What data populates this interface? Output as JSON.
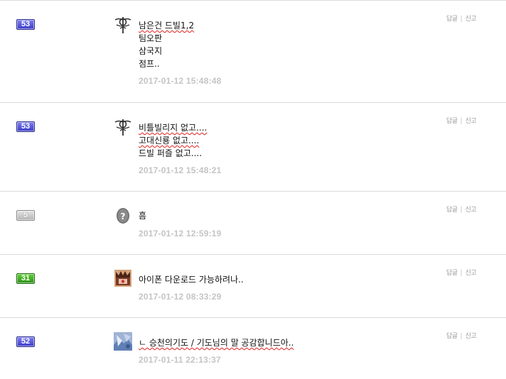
{
  "comments": [
    {
      "level": "53",
      "level_color": "blue",
      "avatar": "alchemy-symbol-icon",
      "lines": [
        "남은건 드빌1,2",
        "팀오판",
        "삼국지",
        "점프.."
      ],
      "date": "2017-01-12 15:48:48",
      "reply_label": "답글",
      "report_label": "신고"
    },
    {
      "level": "53",
      "level_color": "blue",
      "avatar": "alchemy-symbol-icon",
      "lines": [
        "비틀빌리지 없고....",
        "고대신룡 없고....",
        "드빌 퍼즐 없고...."
      ],
      "date": "2017-01-12 15:48:21",
      "reply_label": "답글",
      "report_label": "신고"
    },
    {
      "level": "5",
      "level_color": "gray",
      "avatar": "question-mark-icon",
      "lines": [
        "흠"
      ],
      "date": "2017-01-12 12:59:19",
      "reply_label": "답글",
      "report_label": "신고"
    },
    {
      "level": "31",
      "level_color": "green",
      "avatar": "crown-box-icon",
      "lines": [
        "아이폰 다운로드 가능하려나.."
      ],
      "date": "2017-01-12 08:33:29",
      "reply_label": "답글",
      "report_label": "신고"
    },
    {
      "level": "52",
      "level_color": "blue",
      "avatar": "photo-thumbnail-icon",
      "lines": [
        "ㄴ 승천의기도 / 기도님의 말 공감합니드아.."
      ],
      "date": "2017-01-11 22:13:37",
      "reply_label": "답글",
      "report_label": "신고"
    }
  ]
}
